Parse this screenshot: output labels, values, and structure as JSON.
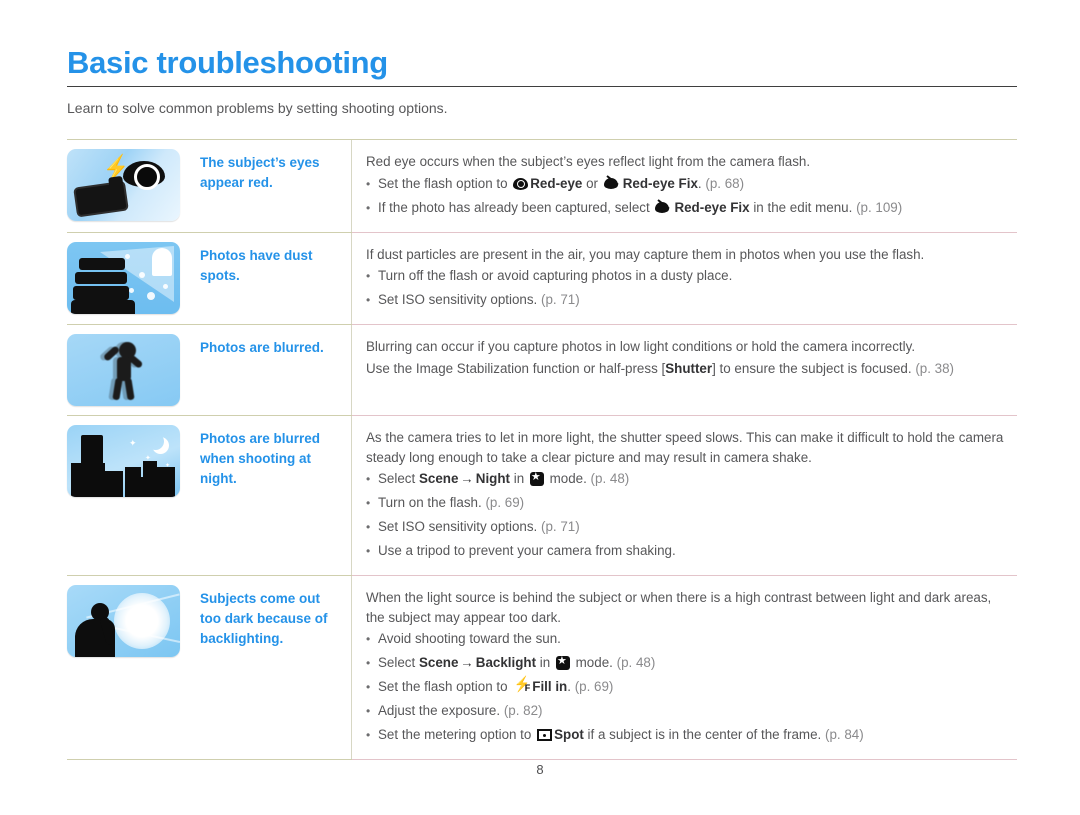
{
  "header": {
    "title": "Basic troubleshooting",
    "subtitle": "Learn to solve common problems by setting shooting options.",
    "title_color": "#2492e8"
  },
  "rows": [
    {
      "icon_name": "red-eye-illustration",
      "label": "The subject’s eyes appear red.",
      "intro": "Red eye occurs when the subject’s eyes reflect light from the camera flash.",
      "bullets": [
        {
          "pre": "Set the flash option to ",
          "icon1": "eye-icon",
          "bold1": "Red-eye",
          "mid": " or ",
          "icon2": "red-eye-fix-icon",
          "bold2": "Red-eye Fix",
          "post": ". ",
          "page": "(p. 68)"
        },
        {
          "pre": "If the photo has already been captured, select ",
          "icon2": "red-eye-fix-icon",
          "bold2": "Red-eye Fix",
          "post": " in the edit menu. ",
          "page": "(p. 109)"
        }
      ]
    },
    {
      "icon_name": "dust-spots-illustration",
      "label": "Photos have dust spots.",
      "intro": "If dust particles are present in the air, you may capture them in photos when you use the flash.",
      "bullets": [
        {
          "pre": "Turn off the flash or avoid capturing photos in a dusty place."
        },
        {
          "pre": "Set ISO sensitivity options. ",
          "page": "(p. 71)"
        }
      ]
    },
    {
      "icon_name": "blurred-photo-illustration",
      "label": "Photos are blurred.",
      "intro": "Blurring can occur if you capture photos in low light conditions or hold the camera incorrectly.",
      "intro2_pre": "Use the Image Stabilization function or half-press [",
      "intro2_key": "Shutter",
      "intro2_post": "] to ensure the subject is focused. ",
      "intro2_page": "(p. 38)",
      "bullets": []
    },
    {
      "icon_name": "night-city-illustration",
      "label": "Photos are blurred when shooting at night.",
      "intro": "As the camera tries to let in more light, the shutter speed slows. This can make it difficult to hold the camera steady long enough to take a clear picture and may result in camera shake.",
      "bullets": [
        {
          "pre": "Select ",
          "bold1": "Scene",
          "arrow": "→",
          "bold2": "Night",
          "mid": " in ",
          "icon3": "scene-mode-icon",
          "post": " mode. ",
          "page": "(p. 48)"
        },
        {
          "pre": "Turn on the flash. ",
          "page": "(p. 69)"
        },
        {
          "pre": "Set ISO sensitivity options. ",
          "page": "(p. 71)"
        },
        {
          "pre": "Use a tripod to prevent your camera from shaking."
        }
      ]
    },
    {
      "icon_name": "backlighting-illustration",
      "label": "Subjects come out too dark because of backlighting.",
      "intro": "When the light source is behind the subject or when there is a high contrast between light and dark areas, the subject may appear too dark.",
      "bullets": [
        {
          "pre": "Avoid shooting toward the sun."
        },
        {
          "pre": "Select ",
          "bold1": "Scene",
          "arrow": "→",
          "bold2": "Backlight",
          "mid": " in ",
          "icon3": "scene-mode-icon",
          "post": " mode. ",
          "page": "(p. 48)"
        },
        {
          "pre": "Set the flash option to ",
          "icon4": "fill-in-flash-icon",
          "bold2": "Fill in",
          "post": ". ",
          "page": "(p. 69)"
        },
        {
          "pre": "Adjust the exposure. ",
          "page": "(p. 82)"
        },
        {
          "pre": "Set the metering option to ",
          "icon5": "spot-metering-icon",
          "bold2": "Spot",
          "post": " if a subject is in the center of the frame. ",
          "page": "(p. 84)"
        }
      ]
    }
  ],
  "footer": {
    "page_number": "8"
  }
}
